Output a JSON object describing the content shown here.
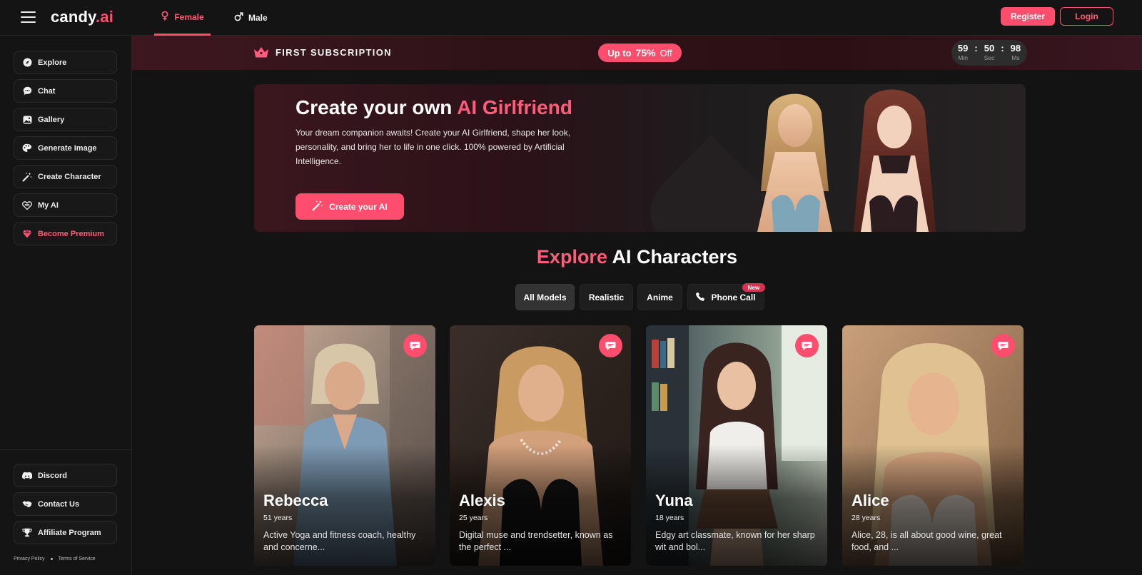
{
  "header": {
    "logo_main": "candy",
    "logo_accent": ".ai",
    "tabs": [
      {
        "label": "Female",
        "icon": "female-icon",
        "active": true
      },
      {
        "label": "Male",
        "icon": "male-icon",
        "active": false
      }
    ],
    "register_label": "Register",
    "login_label": "Login"
  },
  "sidebar": {
    "items": [
      {
        "label": "Explore",
        "icon": "compass-icon"
      },
      {
        "label": "Chat",
        "icon": "chat-bubble-icon"
      },
      {
        "label": "Gallery",
        "icon": "gallery-icon"
      },
      {
        "label": "Generate Image",
        "icon": "palette-icon"
      },
      {
        "label": "Create Character",
        "icon": "magic-wand-icon"
      },
      {
        "label": "My AI",
        "icon": "heart-mask-icon"
      },
      {
        "label": "Become Premium",
        "icon": "diamond-icon"
      }
    ],
    "bottom_items": [
      {
        "label": "Discord",
        "icon": "discord-icon"
      },
      {
        "label": "Contact Us",
        "icon": "handshake-icon"
      },
      {
        "label": "Affiliate Program",
        "icon": "trophy-icon"
      }
    ],
    "footer": {
      "privacy": "Privacy Policy",
      "terms": "Terms of Service"
    }
  },
  "promo": {
    "title": "FIRST SUBSCRIPTION",
    "pill_prefix": "Up to",
    "pill_percent": "75%",
    "pill_suffix": "Off",
    "timer": [
      {
        "value": "59",
        "label": "Min"
      },
      {
        "value": "50",
        "label": "Sec"
      },
      {
        "value": "98",
        "label": "Ms"
      }
    ],
    "timer_separator": ":"
  },
  "hero": {
    "title_prefix": "Create your own",
    "title_accent": "AI Girlfriend",
    "description": "Your dream companion awaits! Create your AI Girlfriend, shape her look, personality, and bring her to life in one click. 100% powered by Artificial Intelligence.",
    "cta_label": "Create your AI"
  },
  "explore": {
    "title_accent": "Explore",
    "title_rest": "AI Characters",
    "filters": [
      {
        "label": "All Models",
        "active": true
      },
      {
        "label": "Realistic",
        "active": false
      },
      {
        "label": "Anime",
        "active": false
      },
      {
        "label": "Phone Call",
        "active": false,
        "icon": "phone-icon"
      }
    ],
    "new_badge": "New"
  },
  "characters": [
    {
      "name": "Rebecca",
      "age": "51 years",
      "description": "Active Yoga and fitness coach, healthy and concerne..."
    },
    {
      "name": "Alexis",
      "age": "25 years",
      "description": "Digital muse and trendsetter, known as the perfect ..."
    },
    {
      "name": "Yuna",
      "age": "18 years",
      "description": "Edgy art classmate, known for her sharp wit and bol..."
    },
    {
      "name": "Alice",
      "age": "28 years",
      "description": "Alice, 28, is all about good wine, great food, and ..."
    }
  ],
  "colors": {
    "accent": "#ff4d6d",
    "background": "#131313",
    "promo_bar": "#2d1217"
  }
}
